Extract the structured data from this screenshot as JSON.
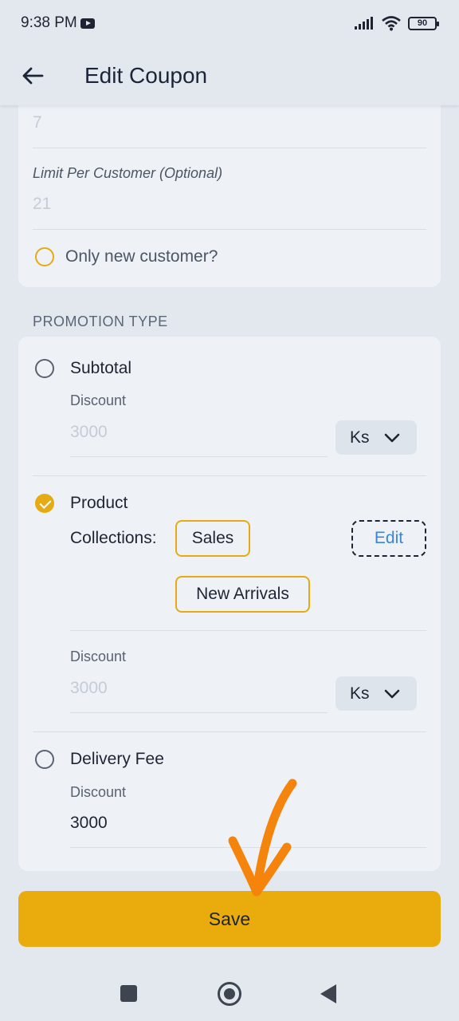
{
  "status_bar": {
    "time": "9:38 PM",
    "battery": "90",
    "icons": [
      "youtube-icon",
      "signal-icon",
      "wifi-icon",
      "battery-icon"
    ]
  },
  "app_bar": {
    "back_icon": "arrow-left-icon",
    "title": "Edit Coupon"
  },
  "limits": {
    "usage_limit_value": "7",
    "limit_per_customer_label": "Limit Per Customer (Optional)",
    "limit_per_customer_value": "21",
    "new_customer_label": "Only new customer?"
  },
  "promotion": {
    "section_title": "PROMOTION TYPE",
    "subtotal": {
      "label": "Subtotal",
      "discount_label": "Discount",
      "discount_placeholder": "3000",
      "currency": "Ks"
    },
    "product": {
      "label": "Product",
      "collections_label": "Collections:",
      "collections": [
        "Sales",
        "New Arrivals"
      ],
      "edit_label": "Edit",
      "discount_label": "Discount",
      "discount_placeholder": "3000",
      "currency": "Ks"
    },
    "delivery_fee": {
      "label": "Delivery Fee",
      "discount_label": "Discount",
      "discount_value": "3000"
    }
  },
  "save_label": "Save",
  "colors": {
    "accent": "#eaab0d",
    "background": "#e3e8ef",
    "card": "#eef2f7",
    "link": "#3b86d6",
    "annotation": "#f5840c"
  }
}
